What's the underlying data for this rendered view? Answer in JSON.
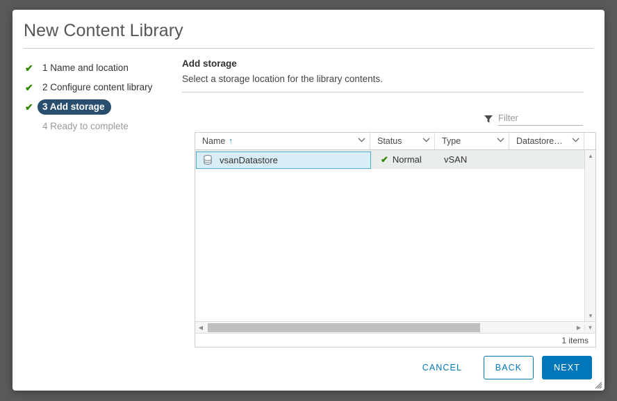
{
  "dialog": {
    "title": "New Content Library"
  },
  "steps": [
    {
      "label": "1 Name and location",
      "state": "done",
      "check": "✔"
    },
    {
      "label": "2 Configure content library",
      "state": "done",
      "check": "✔"
    },
    {
      "label": "3 Add storage",
      "state": "active",
      "check": "✔"
    },
    {
      "label": "4 Ready to complete",
      "state": "pending",
      "check": ""
    }
  ],
  "pane": {
    "heading": "Add storage",
    "description": "Select a storage location for the library contents."
  },
  "filter": {
    "placeholder": "Filter",
    "value": "",
    "icon": "filter-funnel-icon"
  },
  "table": {
    "columns": [
      {
        "label": "Name",
        "sort": "↑",
        "chevron": "⌄"
      },
      {
        "label": "Status",
        "sort": "",
        "chevron": "⌄"
      },
      {
        "label": "Type",
        "sort": "",
        "chevron": "⌄"
      },
      {
        "label": "Datastore…",
        "sort": "",
        "chevron": "⌄"
      }
    ],
    "rows": [
      {
        "name": "vsanDatastore",
        "name_icon": "datastore-icon",
        "status": "Normal",
        "status_icon": "✔",
        "type": "vSAN",
        "datastore_cluster": "",
        "selected": true
      }
    ],
    "footer_count": "1 items",
    "scroll": {
      "up_arrow": "▲",
      "down_arrow": "▼",
      "left_arrow": "◀",
      "right_arrow": "▶",
      "corner_arrow": "▼"
    }
  },
  "buttons": {
    "cancel": "CANCEL",
    "back": "BACK",
    "next": "NEXT"
  },
  "colors": {
    "accent_blue": "#0077b8",
    "active_step_bg": "#2a4e6e",
    "success_green": "#318700",
    "selection_border": "#49afd9",
    "backdrop": "#595959"
  }
}
